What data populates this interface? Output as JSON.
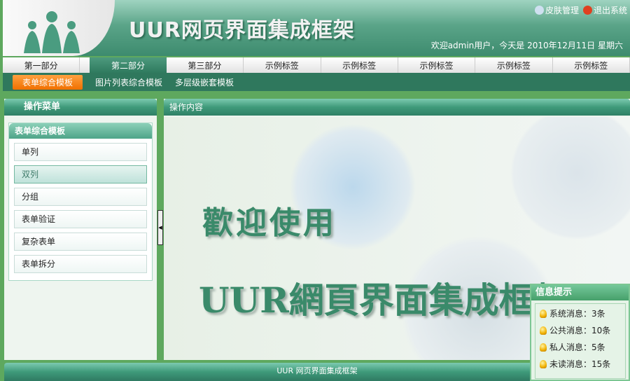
{
  "header": {
    "title": "UUR网页界面集成框架",
    "skin_label": "皮肤管理",
    "logout_label": "退出系统",
    "welcome": "欢迎admin用户，今天是 2010年12月11日 星期六"
  },
  "tabs": [
    {
      "label": "第一部分"
    },
    {
      "label": "第二部分",
      "active": true
    },
    {
      "label": "第三部分"
    },
    {
      "label": "示例标签"
    },
    {
      "label": "示例标签"
    },
    {
      "label": "示例标签"
    },
    {
      "label": "示例标签"
    },
    {
      "label": "示例标签"
    }
  ],
  "subnav": [
    {
      "label": "表单综合模板",
      "active": true
    },
    {
      "label": "图片列表综合模板"
    },
    {
      "label": "多层级嵌套模板"
    }
  ],
  "sidebar": {
    "title": "操作菜单",
    "group": "表单综合模板",
    "items": [
      {
        "label": "单列"
      },
      {
        "label": "双列",
        "active": true
      },
      {
        "label": "分组"
      },
      {
        "label": "表单验证"
      },
      {
        "label": "复杂表单"
      },
      {
        "label": "表单拆分"
      }
    ]
  },
  "main": {
    "title": "操作内容",
    "welcome1": "歡迎使用",
    "welcome2": "UUR網頁界面集成框架"
  },
  "footer": {
    "text": "UUR 网页界面集成框架"
  },
  "info": {
    "title": "信息提示",
    "messages": [
      {
        "label": "系统消息：3条"
      },
      {
        "label": "公共消息：10条"
      },
      {
        "label": "私人消息：5条"
      },
      {
        "label": "未读消息：15条"
      }
    ]
  },
  "colors": {
    "brand": "#3d8b6e",
    "accent": "#f07000",
    "background": "#5ea85e"
  }
}
